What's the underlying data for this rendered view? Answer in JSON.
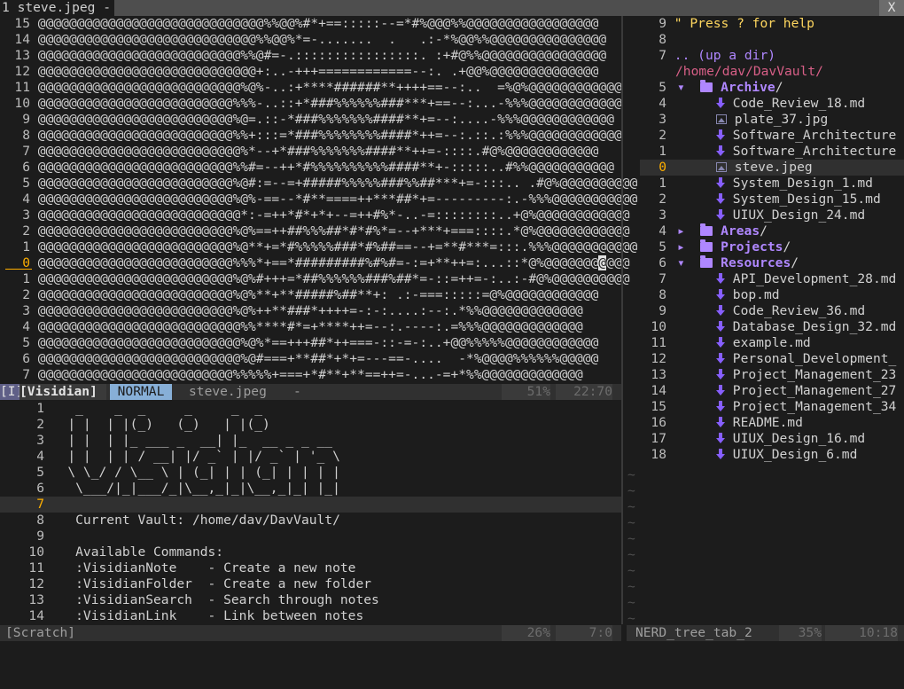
{
  "tabline": {
    "tab_label": "1 steve.jpeg -",
    "close_label": "X"
  },
  "image_buffer": {
    "lines": [
      {
        "num": "15",
        "text": "@@@@@@@@@@@@@@@@@@@@@@@@@@@@@%%@@%#*+==:::::--=*#%@@@%%@@@@@@@@@@@@@@@@@"
      },
      {
        "num": "14",
        "text": "@@@@@@@@@@@@@@@@@@@@@@@@@@@@%%@@%*=-.......  .   .:-*%@@%%@@@@@@@@@@@@@@@"
      },
      {
        "num": "13",
        "text": "@@@@@@@@@@@@@@@@@@@@@@@@@@%%@#=-.::::::::::::::::. :+#@%%@@@@@@@@@@@@@@@@"
      },
      {
        "num": "12",
        "text": "@@@@@@@@@@@@@@@@@@@@@@@@@@@@+:..-+++============--:. .+@@%@@@@@@@@@@@@@@"
      },
      {
        "num": "11",
        "text": "@@@@@@@@@@@@@@@@@@@@@@@@@@%@%-..:+****######**++++==--:..  =%@%@@@@@@@@@@@@"
      },
      {
        "num": "10",
        "text": "@@@@@@@@@@@@@@@@@@@@@@@@@%%%-..::+*###%%%%%%###***+==--:...-%%%@@@@@@@@@@@@"
      },
      {
        "num": "9",
        "text": "@@@@@@@@@@@@@@@@@@@@@@@@@%@=.::-*###%%%%%%%####**+=--:....-%%%@@@@@@@@@@@@"
      },
      {
        "num": "8",
        "text": "@@@@@@@@@@@@@@@@@@@@@@@@@%%+:::=*###%%%%%%%%####*++=--:.::.:%%%@@@@@@@@@@@@"
      },
      {
        "num": "7",
        "text": "@@@@@@@@@@@@@@@@@@@@@@@@@@%*--+*###%%%%%%%####**++=-::::.#@%@@@@@@@@@@@@"
      },
      {
        "num": "6",
        "text": "@@@@@@@@@@@@@@@@@@@@@@@@@%%#=--++*#%%%%%%%%%%####**+-:::::..#%%@@@@@@@@@@@"
      },
      {
        "num": "5",
        "text": "@@@@@@@@@@@@@@@@@@@@@@@@@%@#:=--=+#####%%%%%###%%##***+=-:::.. .#@%@@@@@@@@@@"
      },
      {
        "num": "4",
        "text": "@@@@@@@@@@@@@@@@@@@@@@@@@%@%-==--*#**====++***##*+=---------:.-%%%@@@@@@@@@@@"
      },
      {
        "num": "3",
        "text": "@@@@@@@@@@@@@@@@@@@@@@@@@@*:-=++*#*+*+--=++#%*-..-=::::::::..+@%@@@@@@@@@@@@"
      },
      {
        "num": "2",
        "text": "@@@@@@@@@@@@@@@@@@@@@@@@@%@%==++##%%%##*#*#%*=--+***+===::::.*@%@@@@@@@@@@@@"
      },
      {
        "num": "1",
        "text": "@@@@@@@@@@@@@@@@@@@@@@@@@%@**+=*#%%%%%###*#%##==--+=**#***=:::.%%%@@@@@@@@@@@"
      },
      {
        "num": "0",
        "text": "@@@@@@@@@@@@@@@@@@@@@@@@@%%%*+==*#########%#%#=-:=+**++=:...::*@%@@@@@@@",
        "cursor_char": "@",
        "after": "@@@",
        "current": true
      },
      {
        "num": "1",
        "text": "@@@@@@@@@@@@@@@@@@@@@@@@@%@%#+++=*##%%%%%%###%##*=-::=++=-:..:-#@%@@@@@@@@@@"
      },
      {
        "num": "2",
        "text": "@@@@@@@@@@@@@@@@@@@@@@@@@%@%**+**#####%##**+: .:-===:::::=@%@@@@@@@@@@@@"
      },
      {
        "num": "3",
        "text": "@@@@@@@@@@@@@@@@@@@@@@@@@%@%++**###*++++=-:-:....:--:.*%%@@@@@@@@@@@@@"
      },
      {
        "num": "4",
        "text": "@@@@@@@@@@@@@@@@@@@@@@@@@@%%****#*=+****++=--:.----:.=%%%@@@@@@@@@@@@@"
      },
      {
        "num": "5",
        "text": "@@@@@@@@@@@@@@@@@@@@@@@@@@%@%*==+++##*++===-::-=-:..+@@%%%%%@@@@@@@@@@@@"
      },
      {
        "num": "6",
        "text": "@@@@@@@@@@@@@@@@@@@@@@@@@@%@#===+**##*+*+=---==-....  -*%@@@@%%%%%%@@@@@"
      },
      {
        "num": "7",
        "text": "@@@@@@@@@@@@@@@@@@@@@@@@@%%%%%+===+*#**+**==++=-...-=+*%%@@@@@@@@@@@@@"
      }
    ]
  },
  "status_top": {
    "marker": "[I]",
    "plugin": "[Visidian]",
    "mode": "NORMAL",
    "filename": "steve.jpeg",
    "modified": "-",
    "percent": "51%",
    "position": "22:70"
  },
  "scratch_buffer": {
    "lines": [
      {
        "num": "1",
        "text": "  _    _  _     _     _  _"
      },
      {
        "num": "2",
        "text": " | |  | |(_)   (_)   | |(_)"
      },
      {
        "num": "3",
        "text": " | |  | |_ ___ _  __| |_  __ _ _ __"
      },
      {
        "num": "4",
        "text": " | |  | | / __| |/ _` | |/ _` | '_ \\"
      },
      {
        "num": "5",
        "text": " \\ \\_/ / \\__ \\ | (_| | | (_| | | | |"
      },
      {
        "num": "6",
        "text": "  \\___/|_|___/_|\\__,_|_|\\__,_|_| |_|"
      },
      {
        "num": "7",
        "text": "",
        "current": true
      },
      {
        "num": "8",
        "text": "  Current Vault: /home/dav/DavVault/"
      },
      {
        "num": "9",
        "text": ""
      },
      {
        "num": "10",
        "text": "  Available Commands:"
      },
      {
        "num": "11",
        "text": "  :VisidianNote    - Create a new note"
      },
      {
        "num": "12",
        "text": "  :VisidianFolder  - Create a new folder"
      },
      {
        "num": "13",
        "text": "  :VisidianSearch  - Search through notes"
      },
      {
        "num": "14",
        "text": "  :VisidianLink    - Link between notes"
      }
    ]
  },
  "status_bottom": {
    "name": "[Scratch]",
    "percent": "26%",
    "position": "7:0"
  },
  "tree": {
    "help_num": "9",
    "help_text": "\" Press ? for help",
    "blank_num": "8",
    "up_num": "7",
    "up_text": ".. (up a dir)",
    "root_text": "/home/dav/DavVault/",
    "items": [
      {
        "num": "5",
        "kind": "dir",
        "arrow": "▾",
        "label": "Archive",
        "indent": 0
      },
      {
        "num": "4",
        "kind": "md",
        "label": "Code_Review_18.md",
        "indent": 1
      },
      {
        "num": "3",
        "kind": "img",
        "label": "plate_37.jpg",
        "indent": 1
      },
      {
        "num": "2",
        "kind": "md",
        "label": "Software_Architecture",
        "indent": 1
      },
      {
        "num": "1",
        "kind": "md",
        "label": "Software_Architecture",
        "indent": 1
      },
      {
        "num": "0",
        "kind": "img",
        "label": "steve.jpeg",
        "indent": 1,
        "current": true
      },
      {
        "num": "1",
        "kind": "md",
        "label": "System_Design_1.md",
        "indent": 1
      },
      {
        "num": "2",
        "kind": "md",
        "label": "System_Design_15.md",
        "indent": 1
      },
      {
        "num": "3",
        "kind": "md",
        "label": "UIUX_Design_24.md",
        "indent": 1
      },
      {
        "num": "4",
        "kind": "dir",
        "arrow": "▸",
        "label": "Areas",
        "indent": 0
      },
      {
        "num": "5",
        "kind": "dir",
        "arrow": "▸",
        "label": "Projects",
        "indent": 0
      },
      {
        "num": "6",
        "kind": "dir",
        "arrow": "▾",
        "label": "Resources",
        "indent": 0
      },
      {
        "num": "7",
        "kind": "md",
        "label": "API_Development_28.md",
        "indent": 1
      },
      {
        "num": "8",
        "kind": "md",
        "label": "bop.md",
        "indent": 1
      },
      {
        "num": "9",
        "kind": "md",
        "label": "Code_Review_36.md",
        "indent": 1
      },
      {
        "num": "10",
        "kind": "md",
        "label": "Database_Design_32.md",
        "indent": 1
      },
      {
        "num": "11",
        "kind": "md",
        "label": "example.md",
        "indent": 1
      },
      {
        "num": "12",
        "kind": "md",
        "label": "Personal_Development_",
        "indent": 1
      },
      {
        "num": "13",
        "kind": "md",
        "label": "Project_Management_23",
        "indent": 1
      },
      {
        "num": "14",
        "kind": "md",
        "label": "Project_Management_27",
        "indent": 1
      },
      {
        "num": "15",
        "kind": "md",
        "label": "Project_Management_34",
        "indent": 1
      },
      {
        "num": "16",
        "kind": "md",
        "label": "README.md",
        "indent": 1
      },
      {
        "num": "17",
        "kind": "md",
        "label": "UIUX_Design_16.md",
        "indent": 1
      },
      {
        "num": "18",
        "kind": "md",
        "label": "UIUX_Design_6.md",
        "indent": 1
      }
    ]
  },
  "status_tree": {
    "name": "NERD_tree_tab_2",
    "percent": "35%",
    "position": "10:18"
  },
  "colors": {
    "cursor_line_number": "#ffaf00",
    "mode_bg": "#87afd7",
    "tree_dir": "#af87ff",
    "tree_root": "#d75f87",
    "help": "#ffd75f"
  }
}
